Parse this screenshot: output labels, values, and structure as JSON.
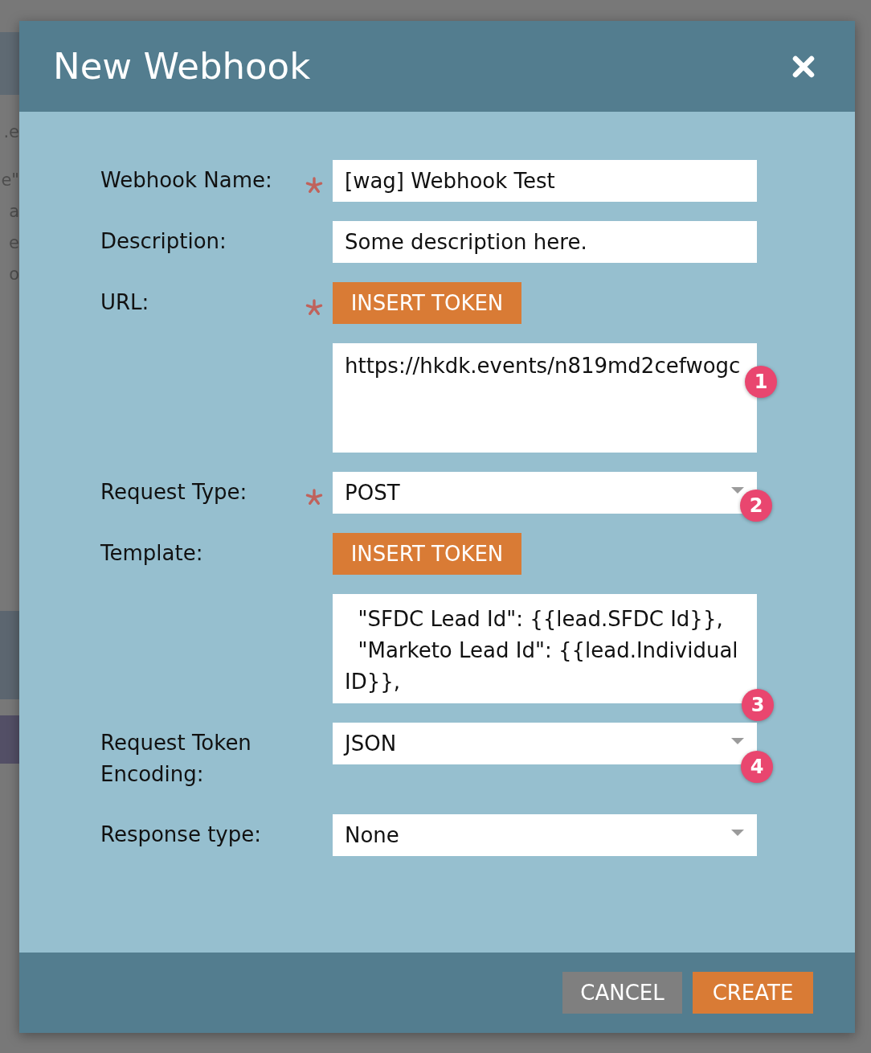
{
  "background_page": {
    "text_fragments": [
      ".e",
      "e\"",
      "a",
      "e",
      "o"
    ]
  },
  "dialog": {
    "title": "New Webhook"
  },
  "fields": [
    {
      "kind": "input",
      "label": "Webhook Name:",
      "required": true,
      "value": "[wag] Webhook Test"
    },
    {
      "kind": "input",
      "label": "Description:",
      "required": false,
      "value": "Some description here."
    },
    {
      "kind": "token_textarea",
      "label": "URL:",
      "required": true,
      "button": "INSERT TOKEN",
      "lines": [
        "https://hkdk.events/n819md2cefwogc"
      ],
      "badge": "1"
    },
    {
      "kind": "select",
      "label": "Request Type:",
      "required": true,
      "value": "POST",
      "badge": "2"
    },
    {
      "kind": "token_textarea",
      "label": "Template:",
      "required": false,
      "button": "INSERT TOKEN",
      "lines": [
        "  \"SFDC Lead Id\": {{lead.SFDC Id}},",
        "  \"Marketo Lead Id\": {{lead.Individual",
        "ID}},"
      ],
      "badge": "3"
    },
    {
      "kind": "select",
      "label": "Request Token Encoding:",
      "required": false,
      "value": "JSON",
      "badge": "4"
    },
    {
      "kind": "select",
      "label": "Response type:",
      "required": false,
      "value": "None"
    }
  ],
  "buttons": [
    {
      "kind": "secondary",
      "label": "CANCEL"
    },
    {
      "kind": "primary",
      "label": "CREATE"
    }
  ]
}
